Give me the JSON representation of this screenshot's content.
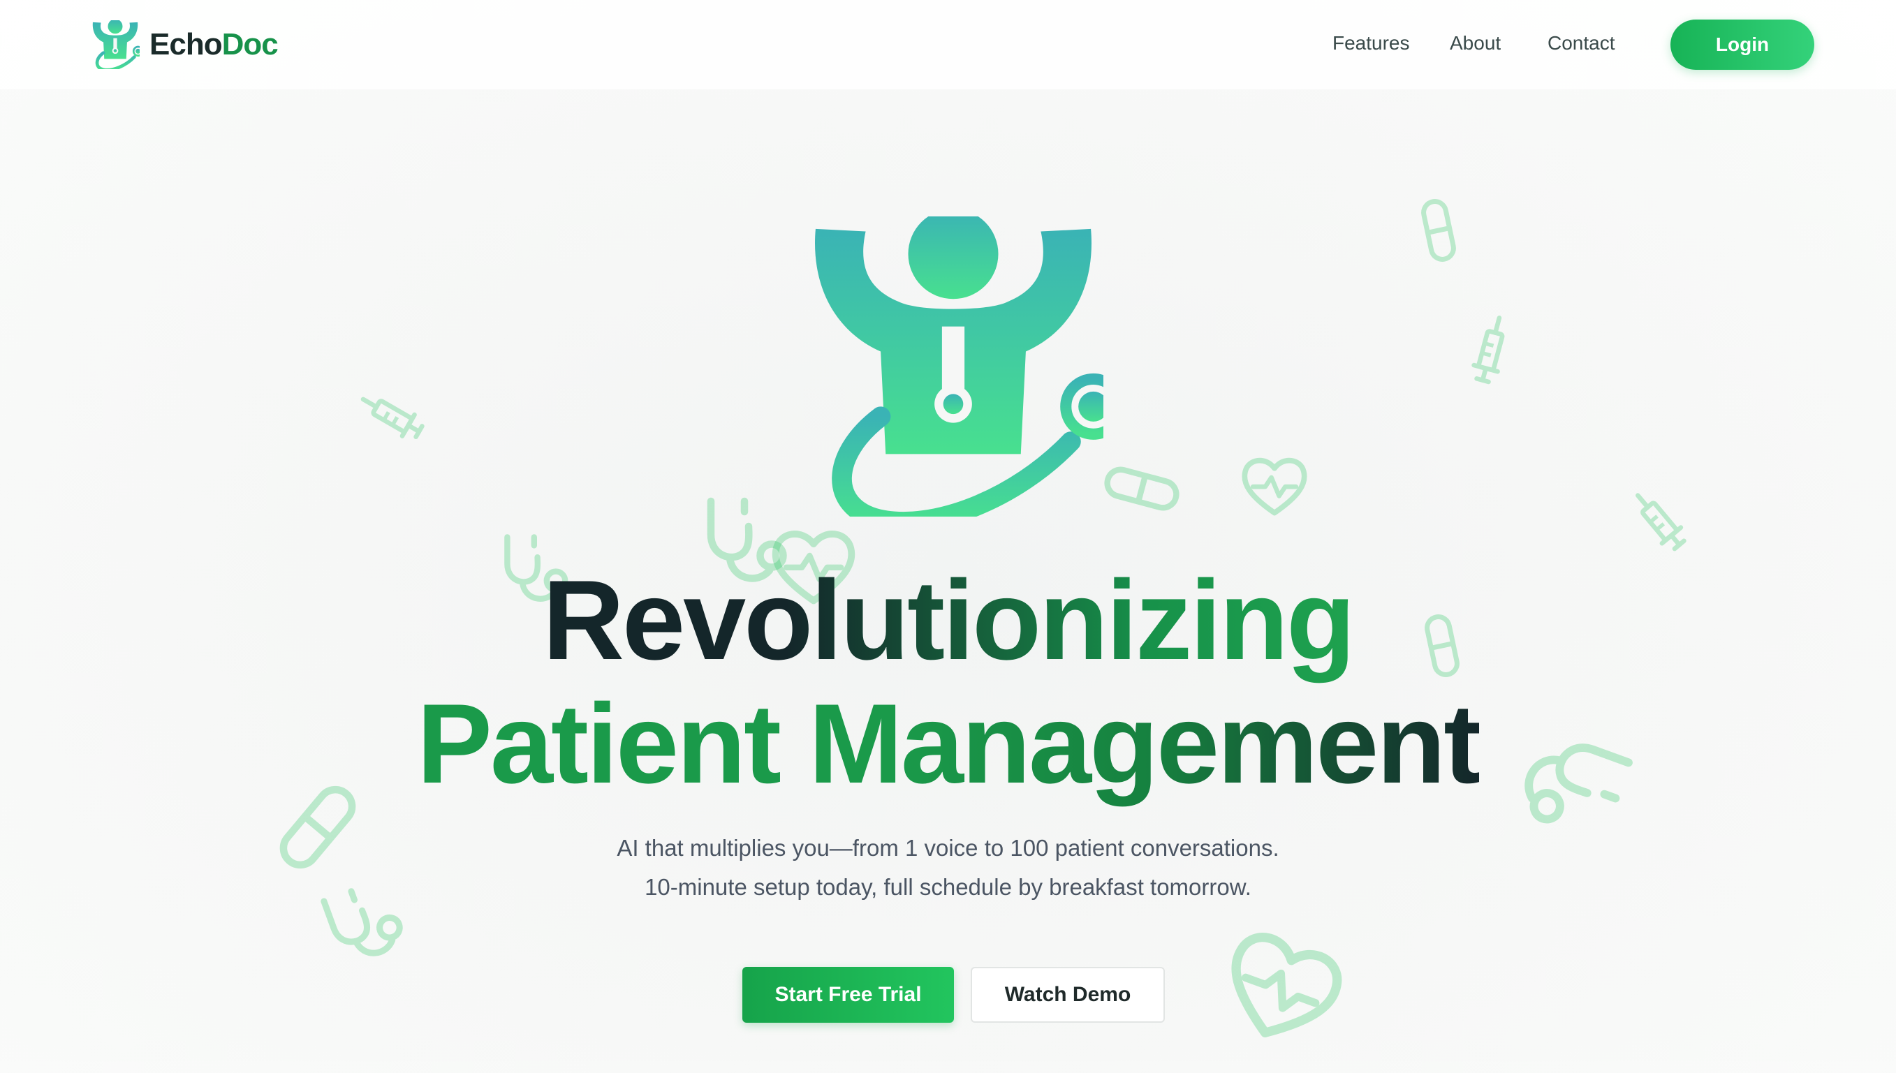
{
  "brand": {
    "part1": "Echo",
    "part2": "Doc"
  },
  "nav": {
    "features": "Features",
    "about": "About",
    "contact": "Contact",
    "login": "Login"
  },
  "hero": {
    "title_line1": "Revolutionizing",
    "title_line2": "Patient Management",
    "subtitle_line1": "AI that multiplies you—from 1 voice to 100 patient conversations.",
    "subtitle_line2": "10-minute setup today, full schedule by breakfast tomorrow.",
    "cta_primary": "Start Free Trial",
    "cta_secondary": "Watch Demo"
  },
  "icons": {
    "logo": "doctor-stethoscope-icon",
    "decorations": [
      "pill-icon",
      "syringe-icon",
      "stethoscope-icon",
      "heart-pulse-icon"
    ]
  },
  "colors": {
    "brand_green": "#17924a",
    "accent_green": "#22c55e",
    "teal": "#3ab3b5",
    "dark_text": "#14262a"
  }
}
